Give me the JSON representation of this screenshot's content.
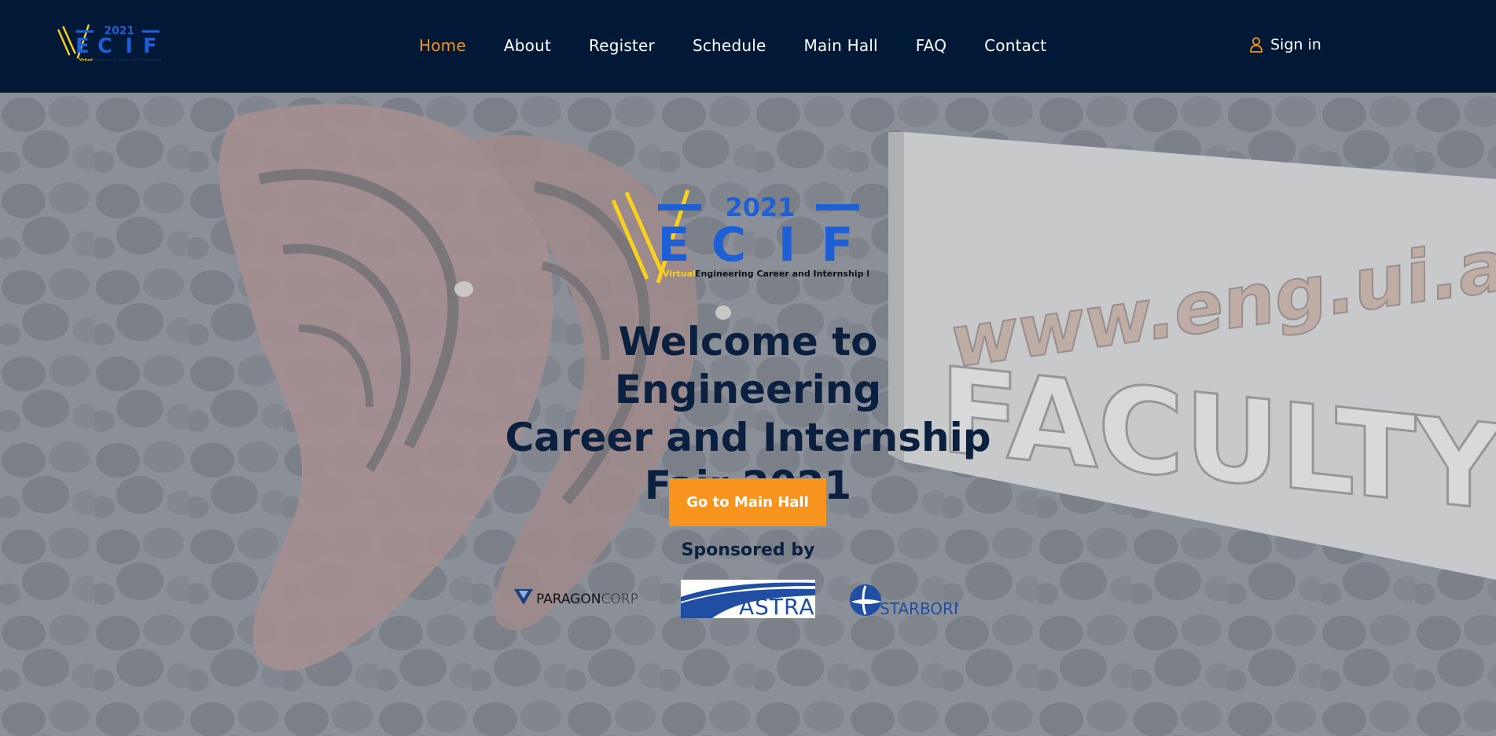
{
  "brand": {
    "logo_year": "2021",
    "logo_letters": [
      "E",
      "C",
      "I",
      "F"
    ],
    "logo_tagline_highlight": "Virtual",
    "logo_tagline": "Engineering Career and Internship Fair",
    "colors": {
      "navy": "#011936",
      "blue": "#1f5fd6",
      "yellow": "#f9d01e",
      "orange": "#f7941d"
    }
  },
  "nav": {
    "items": [
      {
        "label": "Home",
        "active": true
      },
      {
        "label": "About"
      },
      {
        "label": "Register"
      },
      {
        "label": "Schedule"
      },
      {
        "label": "Main Hall"
      },
      {
        "label": "FAQ"
      },
      {
        "label": "Contact"
      }
    ],
    "signin_label": "Sign in",
    "signin_icon": "user-icon"
  },
  "hero": {
    "title_lines": [
      "Welcome to Engineering",
      "Career and Internship",
      "Fair 2021"
    ],
    "cta_label": "Go to Main Hall",
    "sponsored_label": "Sponsored by",
    "background_sign_text": "FACULTY OF E",
    "background_url_text": "www.eng.ui.ac.id"
  },
  "sponsors": [
    {
      "name": "PARAGONCORP",
      "parts": [
        "PARAGON",
        "CORP"
      ]
    },
    {
      "name": "ASTRA"
    },
    {
      "name": "STARBORN"
    }
  ]
}
